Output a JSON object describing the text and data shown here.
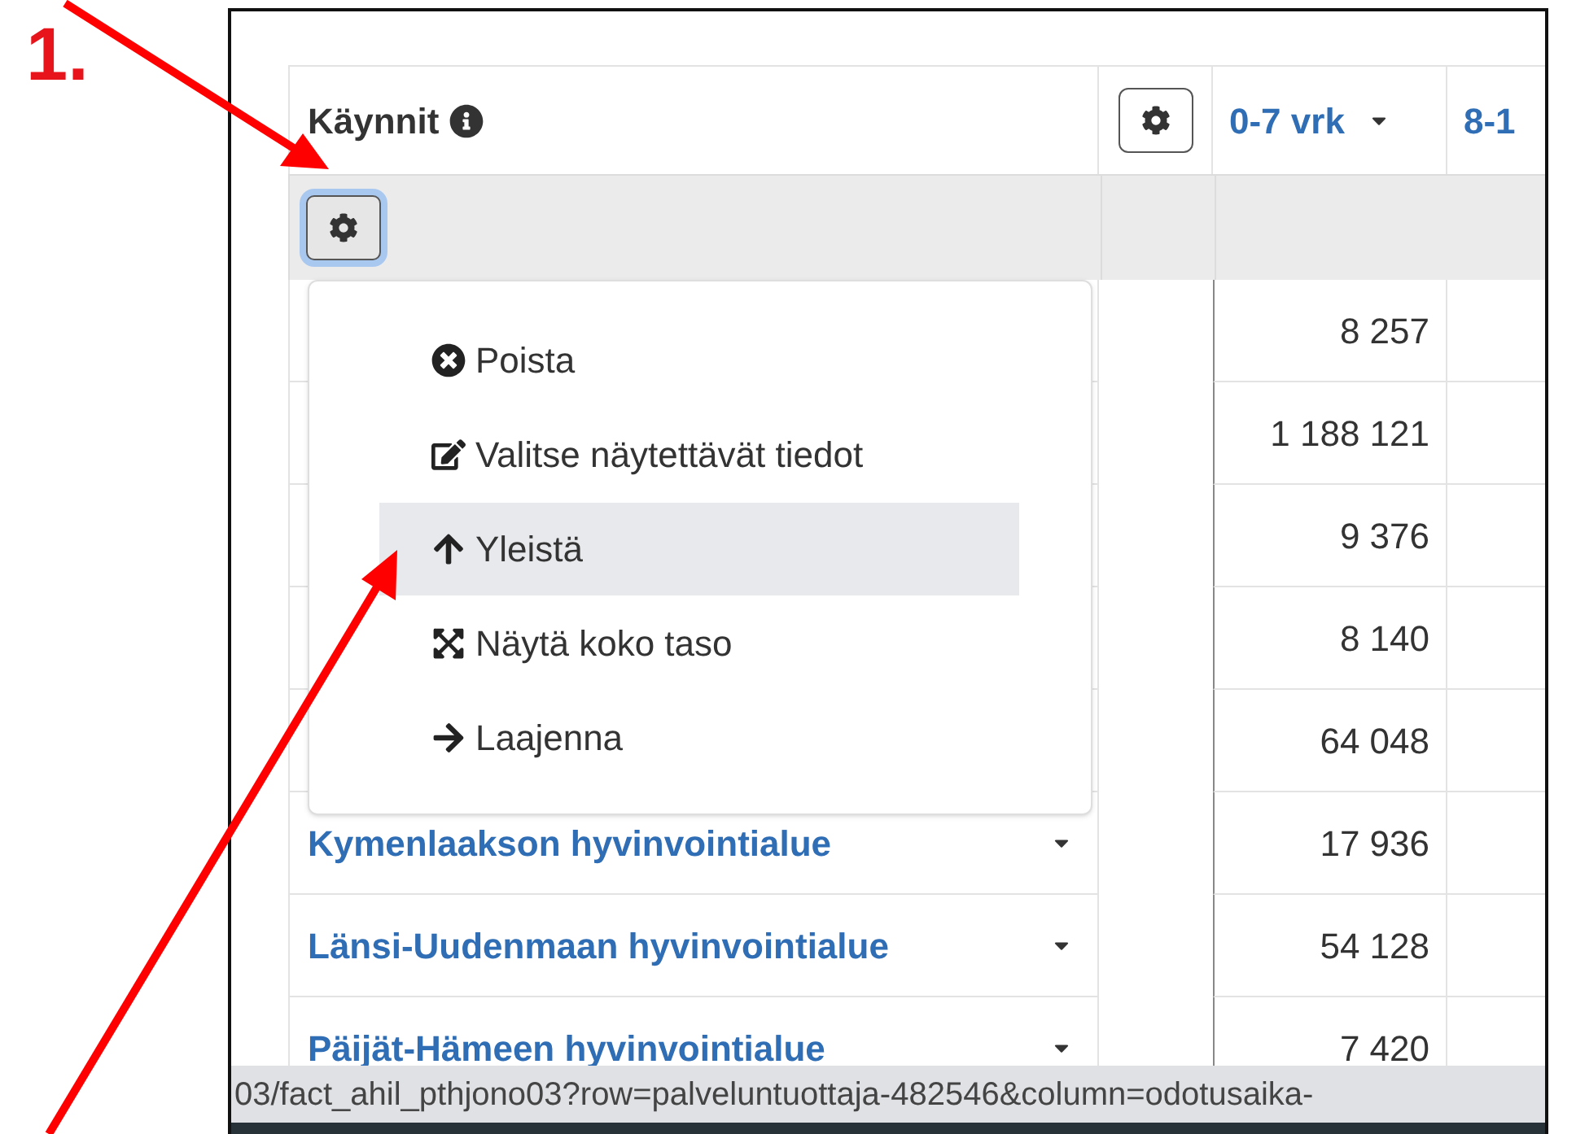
{
  "annotation": {
    "label": "1."
  },
  "table": {
    "title": "Käynnit",
    "columns": [
      {
        "label": "0-7 vrk"
      },
      {
        "label": "8-1"
      }
    ],
    "rows": [
      {
        "value": "8 257"
      },
      {
        "value": "1 188 121"
      },
      {
        "value": "9 376"
      },
      {
        "value": "8 140"
      },
      {
        "value": "64 048"
      },
      {
        "label": "Kymenlaakson hyvinvointialue",
        "value": "17 936"
      },
      {
        "label": "Länsi-Uudenmaan hyvinvointialue",
        "value": "54 128"
      },
      {
        "label": "Päijät-Hämeen hyvinvointialue",
        "value": "7 420"
      }
    ]
  },
  "menu": {
    "items": [
      {
        "label": "Poista",
        "selected": false
      },
      {
        "label": "Valitse näytettävät tiedot",
        "selected": false
      },
      {
        "label": "Yleistä",
        "selected": true
      },
      {
        "label": "Näytä koko taso",
        "selected": false
      },
      {
        "label": "Laajenna",
        "selected": false
      }
    ]
  },
  "status_bar": {
    "url": "03/fact_ahil_pthjono03?row=palveluntuottaja-482546&column=odotusaika-"
  }
}
